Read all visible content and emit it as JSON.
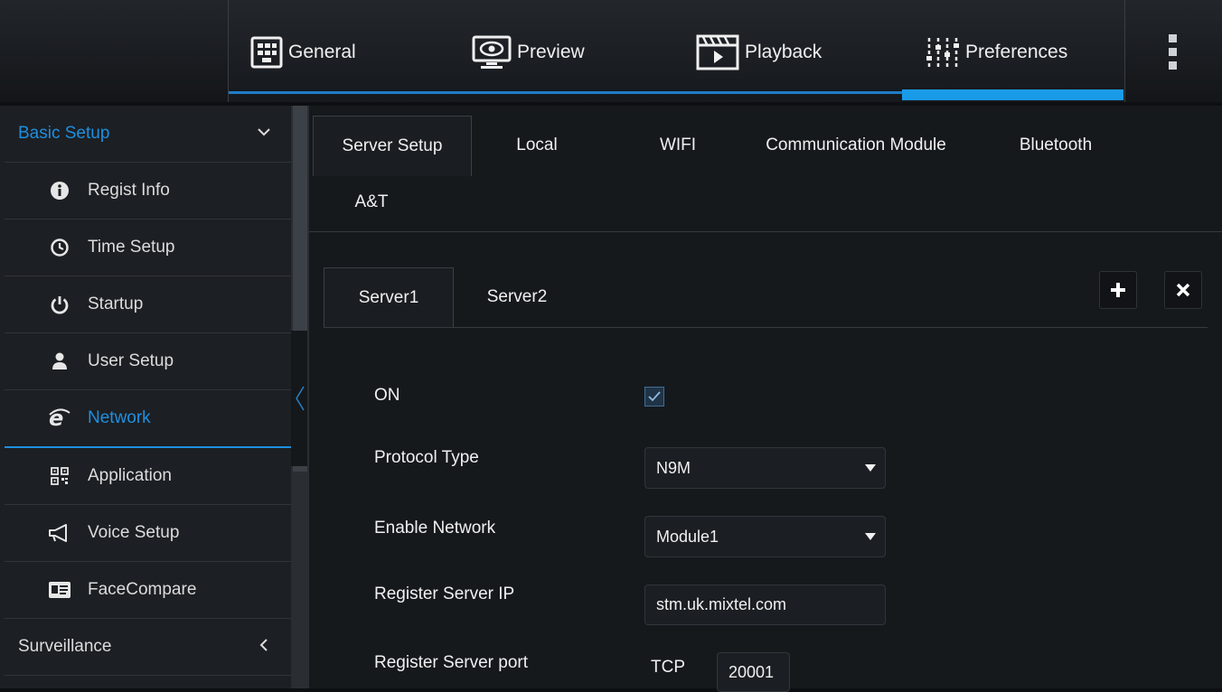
{
  "topbar": {
    "tabs": [
      {
        "label": "General",
        "icon": "grid-panel-icon"
      },
      {
        "label": "Preview",
        "icon": "eye-monitor-icon"
      },
      {
        "label": "Playback",
        "icon": "clapperboard-play-icon"
      },
      {
        "label": "Preferences",
        "icon": "sliders-icon"
      }
    ],
    "active_tab": "Preferences",
    "menu_icon": "kebab-menu-icon"
  },
  "sidebar": {
    "categories": [
      {
        "label": "Basic Setup",
        "expanded": true
      },
      {
        "label": "Surveillance",
        "expanded": false
      }
    ],
    "items": [
      {
        "label": "Regist Info",
        "icon": "info-circle-icon"
      },
      {
        "label": "Time Setup",
        "icon": "clock-icon"
      },
      {
        "label": "Startup",
        "icon": "power-icon"
      },
      {
        "label": "User Setup",
        "icon": "user-icon"
      },
      {
        "label": "Network",
        "icon": "internet-e-icon"
      },
      {
        "label": "Application",
        "icon": "qr-code-icon"
      },
      {
        "label": "Voice Setup",
        "icon": "megaphone-icon"
      },
      {
        "label": "FaceCompare",
        "icon": "id-card-icon"
      }
    ],
    "active_item": "Network"
  },
  "tabs": [
    "Server Setup",
    "Local",
    "WIFI",
    "Communication Module",
    "Bluetooth",
    "A&T"
  ],
  "active_tab": "Server Setup",
  "server_tabs": [
    "Server1",
    "Server2"
  ],
  "active_server_tab": "Server1",
  "form": {
    "on_label": "ON",
    "on_checked": true,
    "protocol_label": "Protocol Type",
    "protocol_value": "N9M",
    "enable_network_label": "Enable Network",
    "enable_network_value": "Module1",
    "server_ip_label": "Register Server IP",
    "server_ip_value": "stm.uk.mixtel.com",
    "server_port_label": "Register Server port",
    "port_protocol": "TCP",
    "port_value": "20001"
  },
  "colors": {
    "accent": "#1e8fe0",
    "background": "#16191c"
  }
}
